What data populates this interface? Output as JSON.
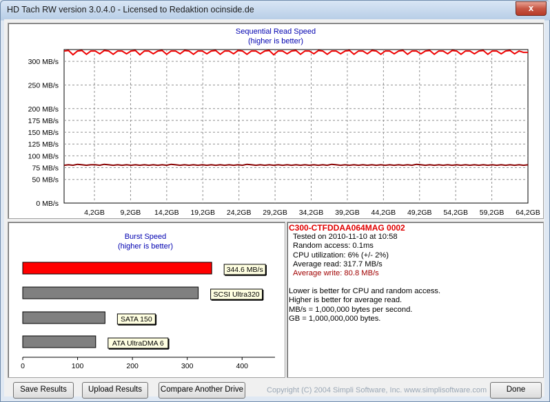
{
  "window": {
    "title": "HD Tach RW version 3.0.4.0 - Licensed to Redaktion ocinside.de",
    "close_label": "x"
  },
  "colors": {
    "read_line": "#ee0000",
    "write_line": "#880000",
    "burst_bar": "#ff0000",
    "reference_bar": "#808080",
    "chart_title": "#0000b0"
  },
  "chart_data": [
    {
      "type": "line",
      "title": "Sequential Read Speed",
      "subtitle": "(higher is better)",
      "ylim": [
        0,
        325
      ],
      "xlim": [
        0,
        64.2
      ],
      "y_ticks": [
        "0 MB/s",
        "50 MB/s",
        "75 MB/s",
        "100 MB/s",
        "125 MB/s",
        "150 MB/s",
        "175 MB/s",
        "200 MB/s",
        "250 MB/s",
        "300 MB/s"
      ],
      "y_tick_values": [
        0,
        50,
        75,
        100,
        125,
        150,
        175,
        200,
        250,
        300
      ],
      "x_ticks": [
        "4,2GB",
        "9,2GB",
        "14,2GB",
        "19,2GB",
        "24,2GB",
        "29,2GB",
        "34,2GB",
        "39,2GB",
        "44,2GB",
        "49,2GB",
        "54,2GB",
        "59,2GB",
        "64,2GB"
      ],
      "x_tick_values": [
        4.2,
        9.2,
        14.2,
        19.2,
        24.2,
        29.2,
        34.2,
        39.2,
        44.2,
        49.2,
        54.2,
        59.2,
        64.2
      ],
      "grid": true,
      "series": [
        {
          "name": "Average read",
          "values": [
            322,
            323,
            314,
            322,
            323,
            315,
            322,
            322,
            316,
            323,
            322,
            315,
            322,
            322,
            316,
            322,
            323,
            314,
            322,
            322,
            316,
            322,
            323,
            315,
            322,
            322,
            316,
            323,
            322,
            315,
            322,
            322,
            316,
            322,
            323,
            315,
            322,
            322,
            316,
            323,
            322,
            315,
            322,
            322,
            316,
            322,
            323,
            314,
            322,
            322,
            316,
            322,
            323,
            315,
            322,
            322,
            316,
            323,
            322,
            315,
            322,
            322,
            316,
            322,
            323,
            315,
            322,
            322,
            316,
            323,
            322,
            315,
            322,
            322,
            316,
            322,
            323,
            315,
            322,
            322,
            316,
            322,
            323,
            315,
            322,
            322,
            316,
            323,
            322,
            315,
            322,
            322,
            316,
            322,
            323,
            315,
            322,
            322,
            316,
            322,
            323,
            316,
            322,
            319,
            319
          ],
          "color": "#ee0000"
        },
        {
          "name": "Average write",
          "values": [
            80,
            81,
            80,
            82,
            81,
            80,
            81,
            81,
            80,
            82,
            81,
            80,
            81,
            80,
            81,
            80,
            81,
            80,
            81,
            80,
            81,
            80,
            81,
            80,
            82,
            81,
            80,
            81,
            80,
            81,
            80,
            81,
            80,
            81,
            80,
            81,
            80,
            81,
            80,
            81,
            80,
            82,
            81,
            80,
            81,
            80,
            81,
            80,
            81,
            80,
            81,
            80,
            81,
            80,
            81,
            80,
            81,
            80,
            81,
            80,
            82,
            81,
            80,
            81,
            80,
            81,
            80,
            81,
            80,
            81,
            80,
            81,
            80,
            81,
            80,
            81,
            80,
            81,
            80,
            82,
            81,
            80,
            81,
            80,
            81,
            80,
            81,
            80,
            81,
            80,
            81,
            80,
            81,
            80,
            81,
            80,
            81,
            80,
            81,
            80,
            81,
            80,
            81,
            80,
            81
          ],
          "color": "#880000"
        }
      ]
    },
    {
      "type": "bar",
      "orientation": "horizontal",
      "title": "Burst Speed",
      "subtitle": "(higher is better)",
      "xlim": [
        0,
        460
      ],
      "x_ticks": [
        "0",
        "100",
        "200",
        "300",
        "400"
      ],
      "x_tick_values": [
        0,
        100,
        200,
        300,
        400
      ],
      "bars": [
        {
          "label": "344.6 MB/s",
          "value": 344.6,
          "color": "#ff0000"
        },
        {
          "label": "SCSI Ultra320",
          "value": 320,
          "color": "#808080"
        },
        {
          "label": "SATA 150",
          "value": 150,
          "color": "#808080"
        },
        {
          "label": "ATA UltraDMA 6",
          "value": 133,
          "color": "#808080"
        }
      ]
    }
  ],
  "info": {
    "drive_name": "C300-CTFDDAA064MAG  0002",
    "tested": "Tested on 2010-11-10 at 10:58",
    "random_access": "Random access: 0.1ms",
    "cpu": "CPU utilization: 6% (+/- 2%)",
    "avg_read": "Average read: 317.7 MB/s",
    "avg_write": "Average write: 80.8 MB/s",
    "note1": "Lower is better for CPU and random access.",
    "note2": "Higher is better for average read.",
    "note3": "MB/s = 1,000,000 bytes per second.",
    "note4": "GB = 1,000,000,000 bytes."
  },
  "buttons": {
    "save": "Save Results",
    "upload": "Upload Results",
    "compare": "Compare Another Drive",
    "done": "Done"
  },
  "copyright": "Copyright (C) 2004 Simpli Software, Inc. www.simplisoftware.com"
}
